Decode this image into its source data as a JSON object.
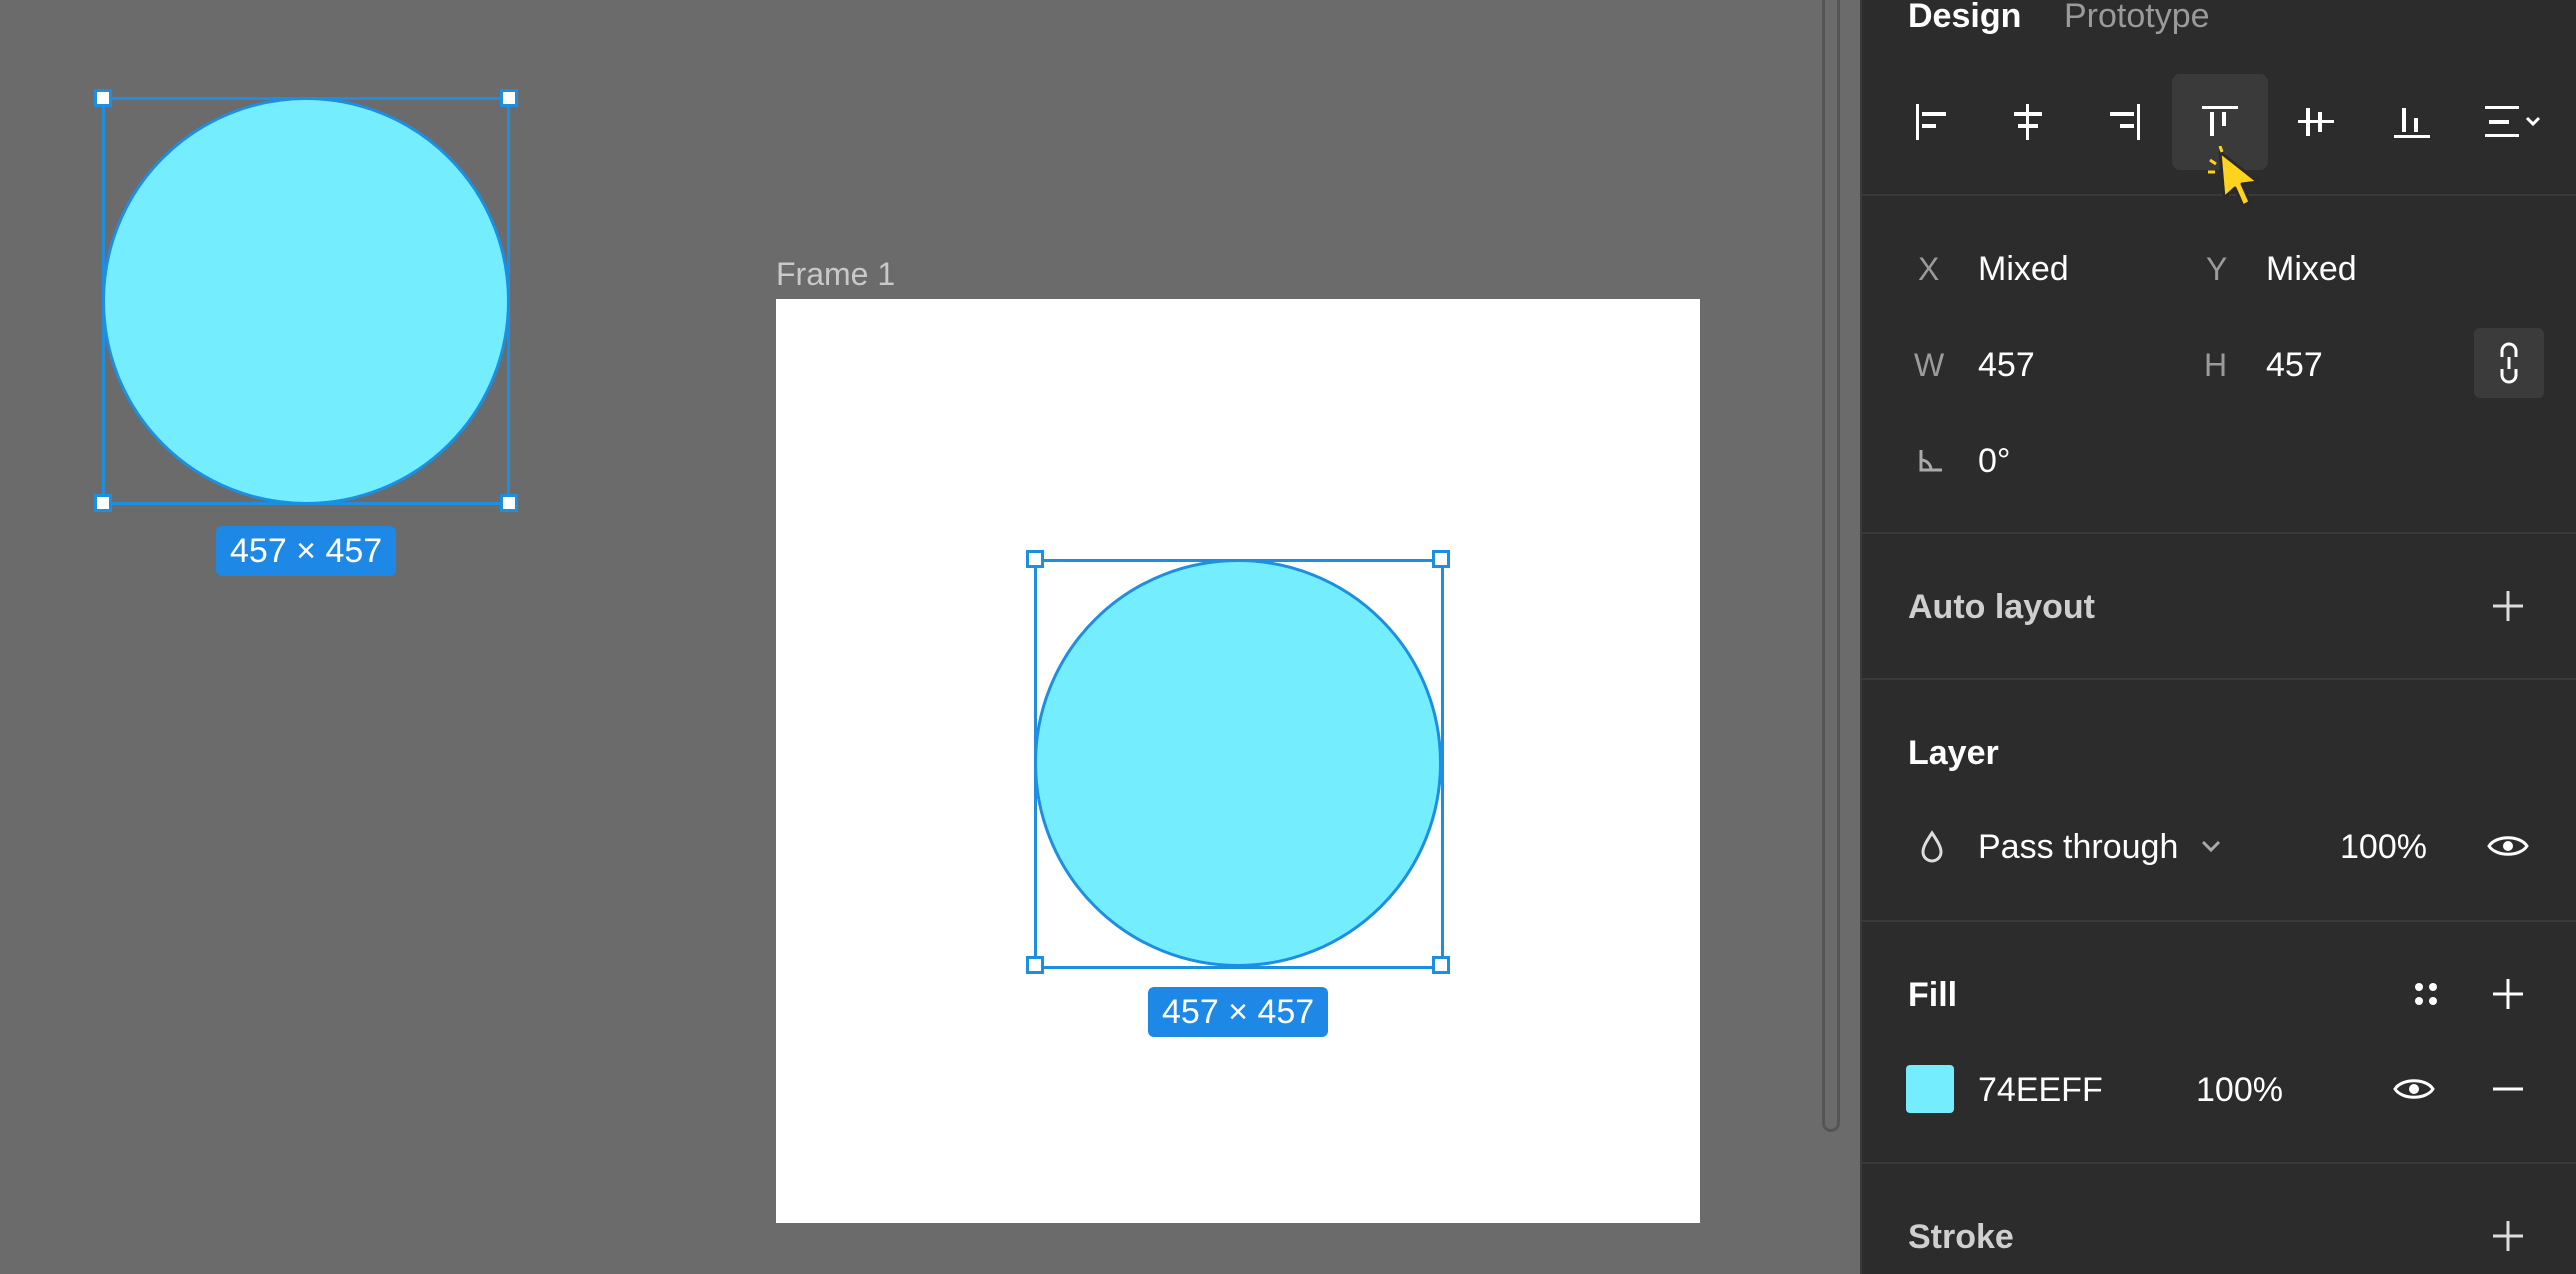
{
  "canvas": {
    "frame_title": "Frame 1",
    "left_circle_size": "457 × 457",
    "frame_circle_size": "457 × 457",
    "circle_color": "#74EEFF",
    "selection_color": "#1E8FE0"
  },
  "panel": {
    "tabs": [
      "Design",
      "Prototype"
    ],
    "align_icons": [
      "align-left-icon",
      "align-horizontal-center-icon",
      "align-right-icon",
      "align-top-icon",
      "align-vertical-center-icon",
      "align-bottom-icon",
      "distribute-menu-icon"
    ],
    "position": {
      "x_label": "X",
      "x_value": "Mixed",
      "y_label": "Y",
      "y_value": "Mixed",
      "w_label": "W",
      "w_value": "457",
      "h_label": "H",
      "h_value": "457",
      "rotation_value": "0°"
    },
    "auto_layout": {
      "title": "Auto layout"
    },
    "layer": {
      "title": "Layer",
      "blend_mode": "Pass through",
      "opacity": "100%"
    },
    "fill": {
      "title": "Fill",
      "hex": "74EEFF",
      "opacity": "100%",
      "color": "#74EEFF"
    },
    "stroke": {
      "title": "Stroke"
    }
  }
}
